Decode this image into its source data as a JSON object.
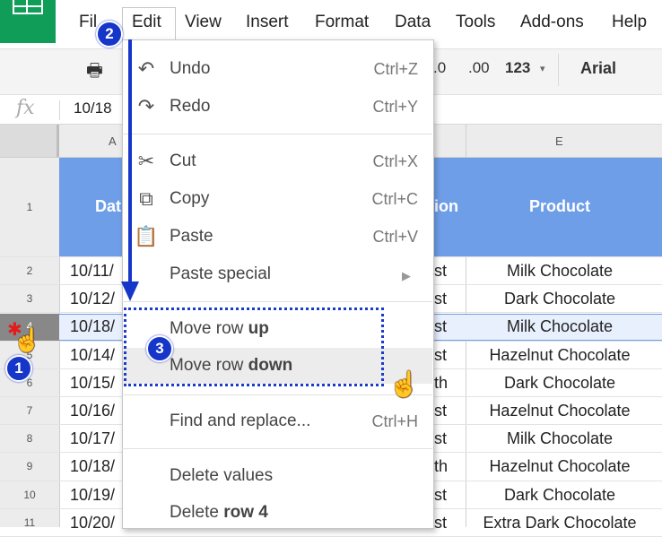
{
  "menubar": {
    "items": [
      "File",
      "Edit",
      "View",
      "Insert",
      "Format",
      "Data",
      "Tools",
      "Add-ons",
      "Help"
    ],
    "file_visible": "Fil"
  },
  "toolbar": {
    "decimal_decrease": ".0",
    "decimal_increase": ".00",
    "more_formats": "123",
    "font": "Arial"
  },
  "formula_bar": {
    "fx": "fx",
    "value": "10/18"
  },
  "columns": {
    "a": "A",
    "e": "E"
  },
  "header_row": {
    "date": "Dat",
    "region": "ion",
    "product": "Product"
  },
  "rows": [
    {
      "num": "2",
      "date": "10/11/",
      "region": "st",
      "product": "Milk Chocolate"
    },
    {
      "num": "3",
      "date": "10/12/",
      "region": "st",
      "product": "Dark Chocolate"
    },
    {
      "num": "4",
      "date": "10/18/",
      "region": "st",
      "product": "Milk Chocolate"
    },
    {
      "num": "5",
      "date": "10/14/",
      "region": "st",
      "product": "Hazelnut Chocolate"
    },
    {
      "num": "6",
      "date": "10/15/",
      "region": "th",
      "product": "Dark Chocolate"
    },
    {
      "num": "7",
      "date": "10/16/",
      "region": "st",
      "product": "Hazelnut Chocolate"
    },
    {
      "num": "8",
      "date": "10/17/",
      "region": "st",
      "product": "Milk Chocolate"
    },
    {
      "num": "9",
      "date": "10/18/",
      "region": "th",
      "product": "Hazelnut Chocolate"
    },
    {
      "num": "10",
      "date": "10/19/",
      "region": "st",
      "product": "Dark Chocolate"
    },
    {
      "num": "11",
      "date": "10/20/",
      "region": "st",
      "product": "Extra Dark Chocolate"
    }
  ],
  "header_row_num": "1",
  "edit_menu": {
    "undo": {
      "label": "Undo",
      "shortcut": "Ctrl+Z"
    },
    "redo": {
      "label": "Redo",
      "shortcut": "Ctrl+Y"
    },
    "cut": {
      "label": "Cut",
      "shortcut": "Ctrl+X"
    },
    "copy": {
      "label": "Copy",
      "shortcut": "Ctrl+C"
    },
    "paste": {
      "label": "Paste",
      "shortcut": "Ctrl+V"
    },
    "paste_special": {
      "label": "Paste special"
    },
    "move_row_up": {
      "prefix": "Move row ",
      "bold": "up"
    },
    "move_row_down": {
      "prefix": "Move row ",
      "bold": "down"
    },
    "find_replace": {
      "label": "Find and replace...",
      "shortcut": "Ctrl+H"
    },
    "delete_values": {
      "label": "Delete values"
    },
    "delete_row": {
      "prefix": "Delete ",
      "bold": "row 4"
    }
  },
  "annotations": {
    "step1": "1",
    "step2": "2",
    "step3": "3",
    "accent_color": "#1536c9"
  },
  "colors": {
    "header_blue": "#6f9ee8",
    "sheets_green": "#0f9d58"
  }
}
